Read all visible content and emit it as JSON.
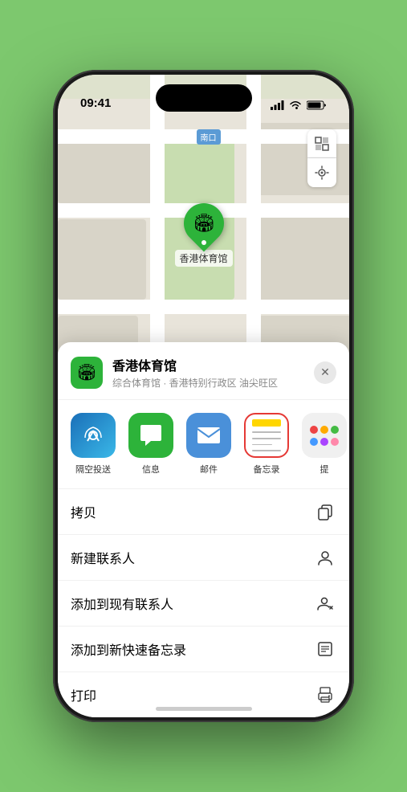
{
  "statusBar": {
    "time": "09:41",
    "location_arrow": "▶"
  },
  "mapLabel": {
    "north_exit": "南口"
  },
  "stadiumMarker": {
    "name": "香港体育馆",
    "emoji": "🏟"
  },
  "locationCard": {
    "name": "香港体育馆",
    "subtitle": "综合体育馆 · 香港特别行政区 油尖旺区"
  },
  "shareApps": [
    {
      "id": "airdrop",
      "label": "隔空投送",
      "emoji": "📡"
    },
    {
      "id": "messages",
      "label": "信息",
      "emoji": "💬"
    },
    {
      "id": "mail",
      "label": "邮件",
      "emoji": "✉️"
    },
    {
      "id": "notes",
      "label": "备忘录",
      "emoji": ""
    },
    {
      "id": "more",
      "label": "提",
      "emoji": ""
    }
  ],
  "actions": [
    {
      "id": "copy",
      "label": "拷贝"
    },
    {
      "id": "new-contact",
      "label": "新建联系人"
    },
    {
      "id": "add-existing",
      "label": "添加到现有联系人"
    },
    {
      "id": "quick-note",
      "label": "添加到新快速备忘录"
    },
    {
      "id": "print",
      "label": "打印"
    }
  ],
  "actionIcons": {
    "copy": "⎘",
    "new-contact": "👤",
    "add-existing": "👤",
    "quick-note": "📋",
    "print": "🖨"
  }
}
